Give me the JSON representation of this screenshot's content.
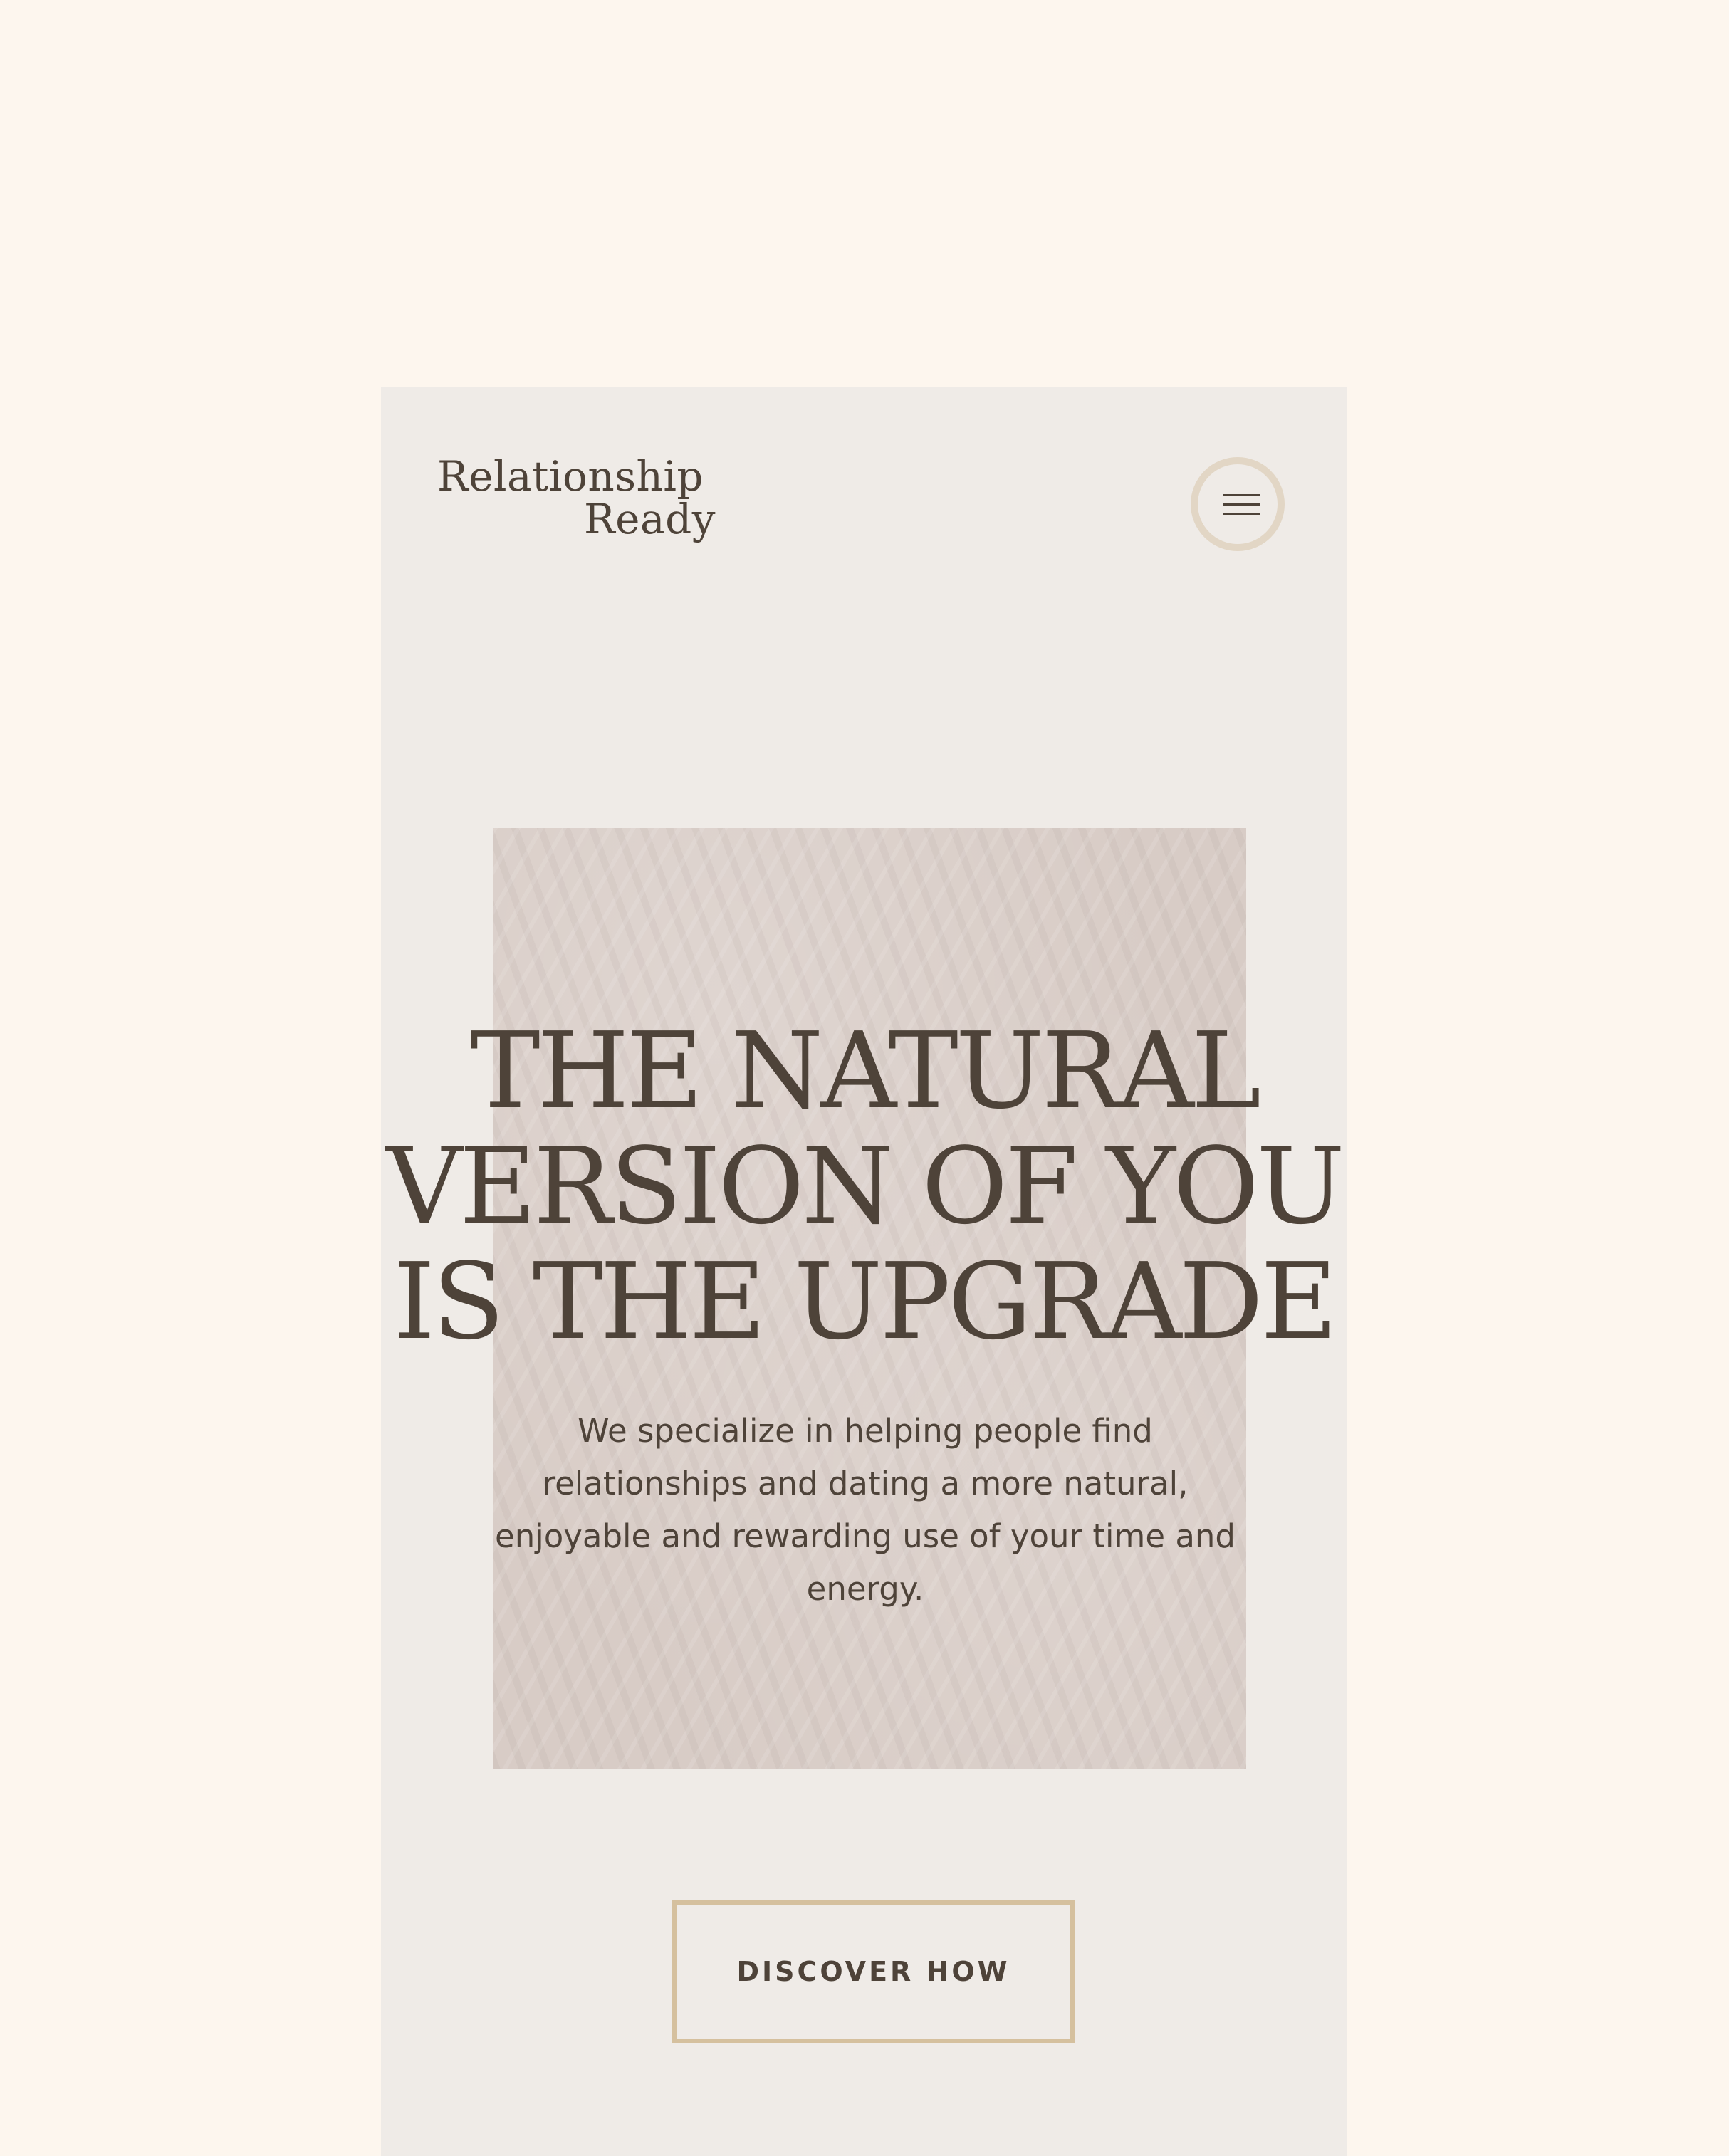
{
  "colors": {
    "page_background": "#fdf6ee",
    "panel_background": "#efebe7",
    "text": "#4e4339",
    "accent_border": "#d5c09e",
    "menu_ring": "#e2d6c5",
    "texture": "#d8ccc6"
  },
  "header": {
    "logo_line1": "Relationship",
    "logo_line2": "Ready",
    "menu_icon": "hamburger-menu-icon"
  },
  "hero": {
    "headline_line1": "THE NATURAL",
    "headline_line2": "VERSION OF YOU",
    "headline_line3": "IS THE UPGRADE",
    "subtext": "We specialize in helping people find relationships and dating a more natural, enjoyable and rewarding use of your time and energy.",
    "cta_label": "DISCOVER HOW"
  }
}
